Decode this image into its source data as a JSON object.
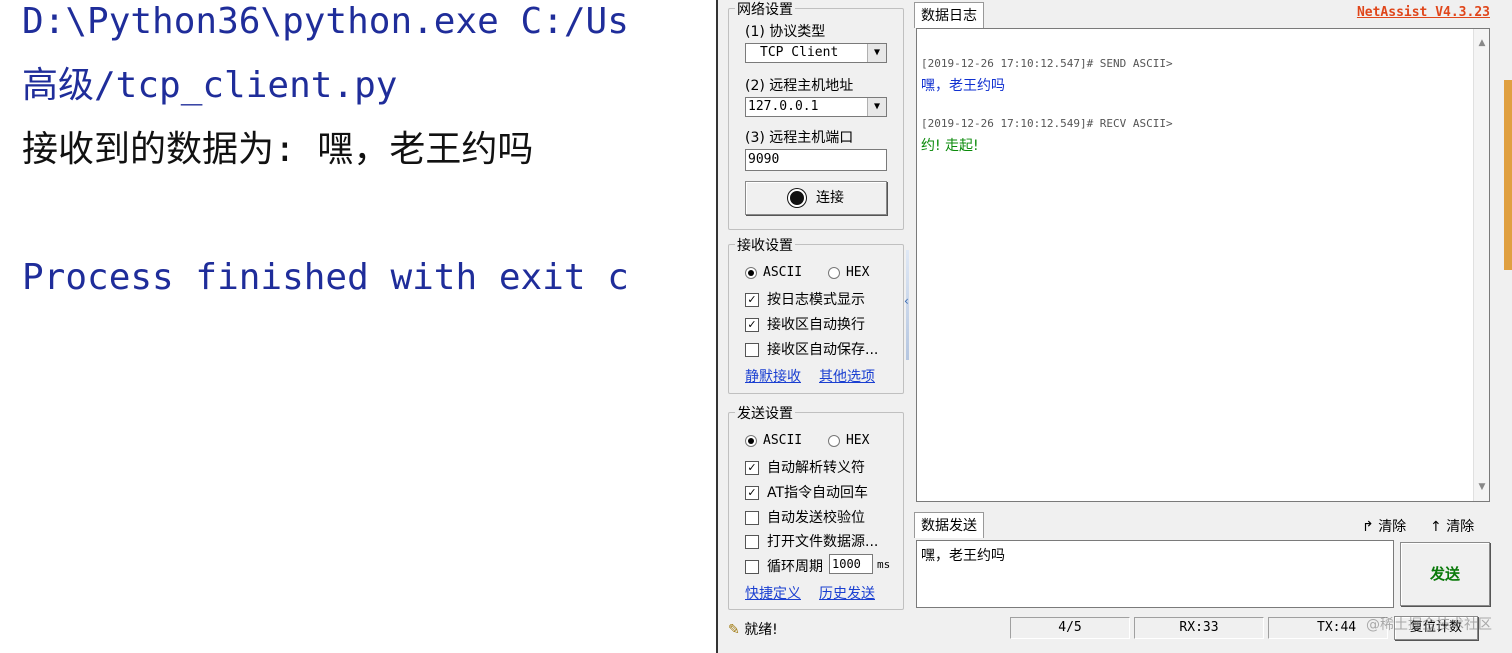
{
  "console": {
    "line1": "D:\\Python36\\python.exe C:/Us",
    "line2": " 高级/tcp_client.py",
    "line3": "接收到的数据为: 嘿，老王约吗",
    "line4": "Process finished with exit c"
  },
  "netassist": {
    "brand": "NetAssist V4.3.23",
    "network": {
      "title": "网络设置",
      "protocol_label": "(1) 协议类型",
      "protocol_value": "TCP Client",
      "host_label": "(2) 远程主机地址",
      "host_value": "127.0.0.1",
      "port_label": "(3) 远程主机端口",
      "port_value": "9090",
      "connect_label": "连接"
    },
    "receive": {
      "title": "接收设置",
      "ascii": "ASCII",
      "hex": "HEX",
      "opt1": "按日志模式显示",
      "opt2": "接收区自动换行",
      "opt3": "接收区自动保存...",
      "link1": "静默接收",
      "link2": "其他选项"
    },
    "send": {
      "title": "发送设置",
      "ascii": "ASCII",
      "hex": "HEX",
      "opt1": "自动解析转义符",
      "opt2": "AT指令自动回车",
      "opt3": "自动发送校验位",
      "opt4": "打开文件数据源...",
      "opt5": "循环周期",
      "period_value": "1000",
      "period_unit": "ms",
      "link1": "快捷定义",
      "link2": "历史发送"
    },
    "log": {
      "tab": "数据日志",
      "entry1_meta": "[2019-12-26 17:10:12.547]# SEND ASCII>",
      "entry1_text": "嘿，老王约吗",
      "entry2_meta": "[2019-12-26 17:10:12.549]# RECV ASCII>",
      "entry2_text": "约! 走起!"
    },
    "sendarea": {
      "tab": "数据发送",
      "clear1": "清除",
      "clear2": "清除",
      "text": "嘿，老王约吗",
      "send_button": "发送"
    },
    "status": {
      "ready": "就绪!",
      "count": "4/5",
      "rx": "RX:33",
      "tx": "TX:44",
      "reset": "复位计数"
    },
    "watermark": "@稀土掘金技术社区"
  }
}
